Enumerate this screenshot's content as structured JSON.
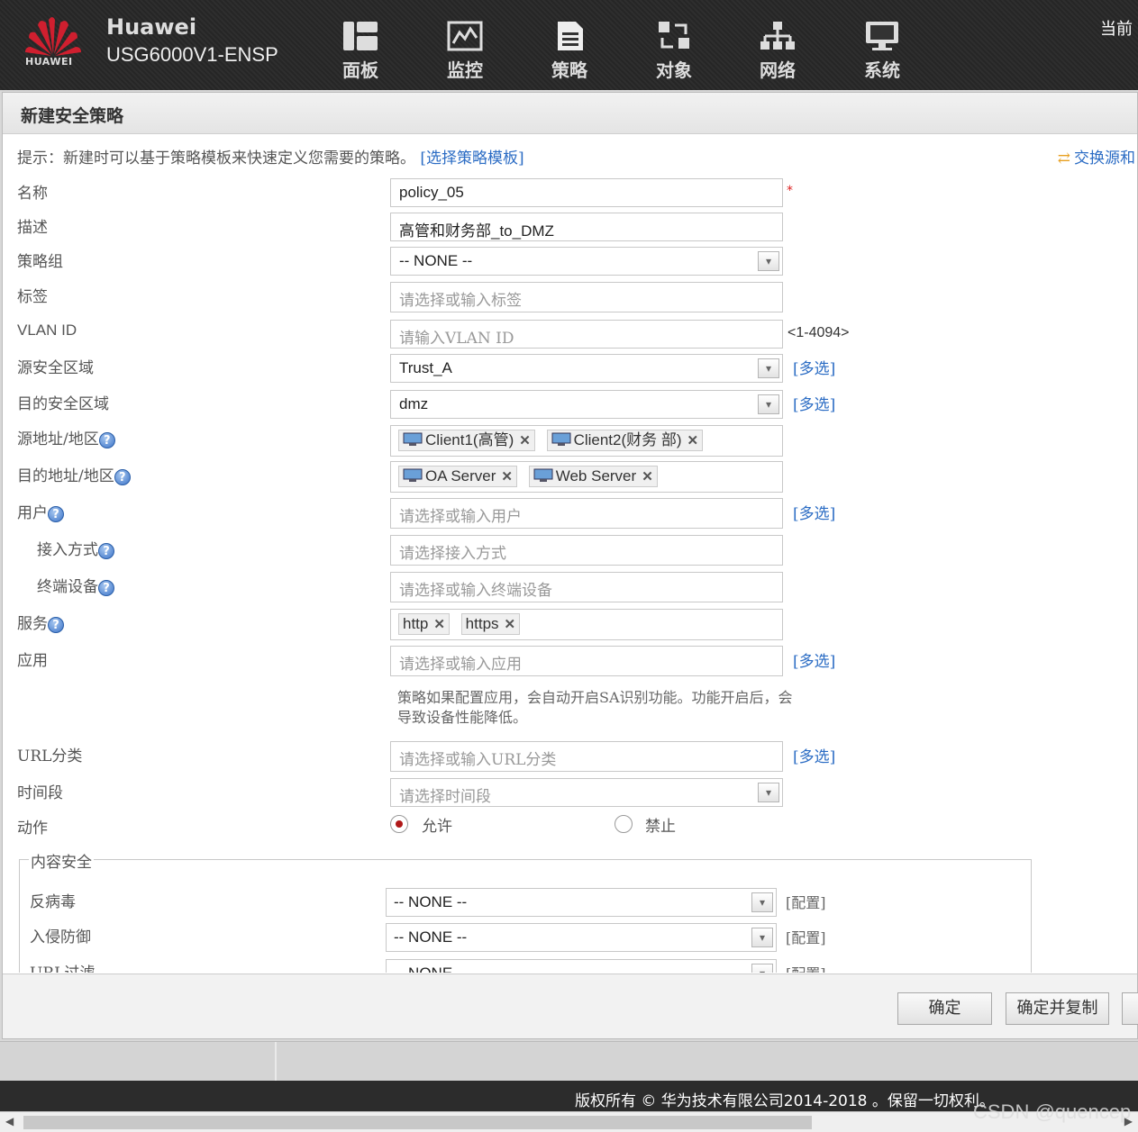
{
  "header": {
    "logo_text": "HUAWEI",
    "brand": "Huawei",
    "model": "USG6000V1-ENSP",
    "current_label": "当前",
    "nav": [
      {
        "label": "面板",
        "icon": "dashboard-icon"
      },
      {
        "label": "监控",
        "icon": "monitor-icon"
      },
      {
        "label": "策略",
        "icon": "policy-icon"
      },
      {
        "label": "对象",
        "icon": "object-icon"
      },
      {
        "label": "网络",
        "icon": "network-icon"
      },
      {
        "label": "系统",
        "icon": "system-icon"
      }
    ]
  },
  "dialog": {
    "title": "新建安全策略",
    "tip": "提示：新建时可以基于策略模板来快速定义您需要的策略。",
    "tip_link": "[选择策略模板]",
    "swap_link": "交换源和",
    "labels": {
      "name": "名称",
      "description": "描述",
      "policy_group": "策略组",
      "tag": "标签",
      "vlan_id": "VLAN ID",
      "src_zone": "源安全区域",
      "dst_zone": "目的安全区域",
      "src_addr": "源地址/地区",
      "dst_addr": "目的地址/地区",
      "user": "用户",
      "access_mode": "接入方式",
      "terminal": "终端设备",
      "service": "服务",
      "application": "应用",
      "url_category": "URL分类",
      "time_range": "时间段",
      "action": "动作"
    },
    "values": {
      "name": "policy_05",
      "description": "高管和财务部_to_DMZ",
      "policy_group": "-- NONE --",
      "src_zone": "Trust_A",
      "dst_zone": "dmz"
    },
    "placeholders": {
      "tag": "请选择或输入标签",
      "vlan_id": "请输入VLAN ID",
      "user": "请选择或输入用户",
      "access_mode": "请选择接入方式",
      "terminal": "请选择或输入终端设备",
      "application": "请选择或输入应用",
      "url_category": "请选择或输入URL分类",
      "time_range": "请选择时间段"
    },
    "vlan_range": "<1-4094>",
    "multi_select": "[多选]",
    "src_addresses": [
      "Client1(高管)",
      "Client2(财务 部)"
    ],
    "dst_addresses": [
      "OA Server",
      "Web Server"
    ],
    "services": [
      "http",
      "https"
    ],
    "app_note": "策略如果配置应用，会自动开启SA识别功能。功能开启后，会导致设备性能降低。",
    "action": {
      "allow": "允许",
      "deny": "禁止",
      "selected": "允许"
    },
    "content_security": {
      "legend": "内容安全",
      "config_label": "[配置]",
      "rows": [
        {
          "label": "反病毒",
          "value": "-- NONE --"
        },
        {
          "label": "入侵防御",
          "value": "-- NONE --"
        },
        {
          "label": "URL过滤",
          "value": "-- NONE --"
        }
      ]
    },
    "buttons": {
      "ok": "确定",
      "ok_copy": "确定并复制"
    }
  },
  "footer": {
    "copyright": "版权所有 © 华为技术有限公司2014-2018 。保留一切权利。",
    "watermark": "CSDN @quencep"
  },
  "colors": {
    "brand_red": "#cf1f2f",
    "link_blue": "#2b6cc4",
    "header_bg": "#2b2b2b"
  }
}
